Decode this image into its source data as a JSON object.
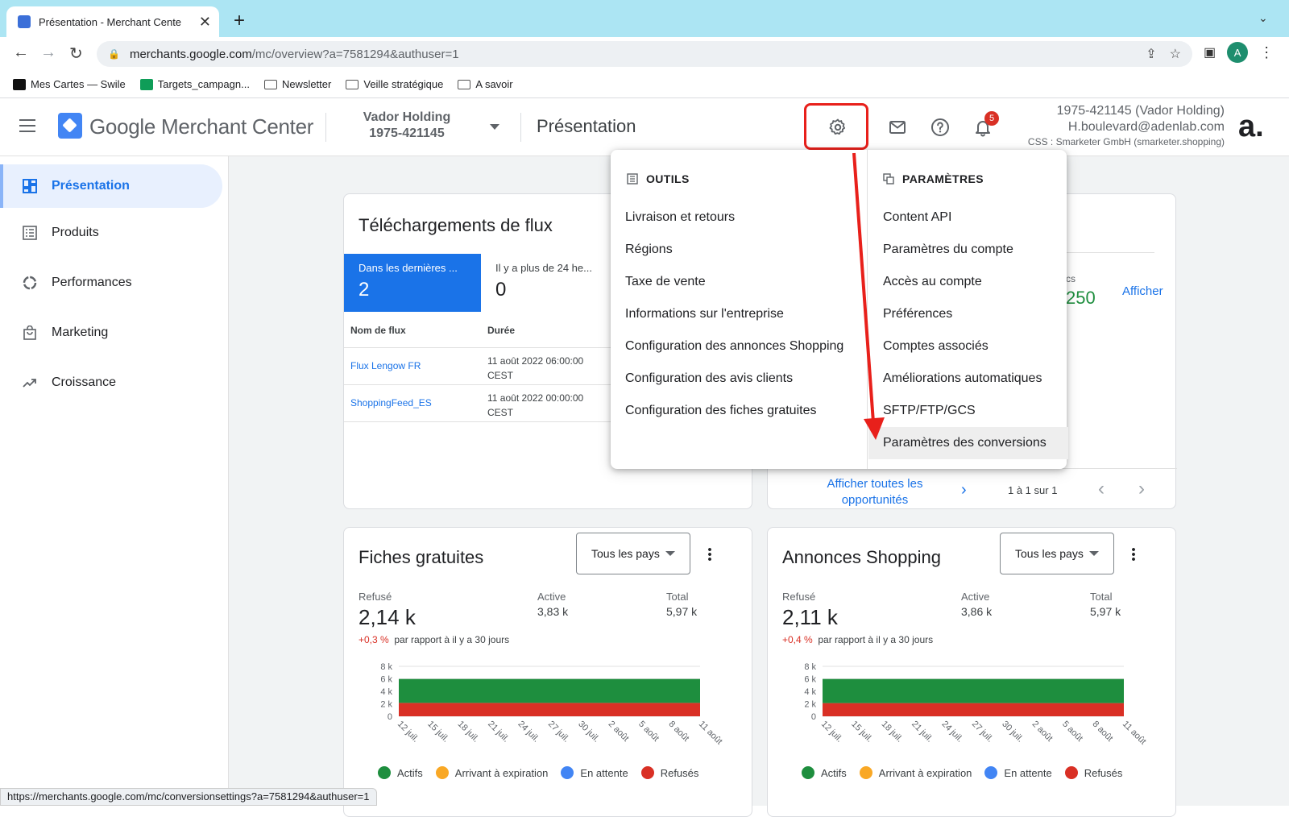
{
  "browser": {
    "tab_title": "Présentation - Merchant Cente",
    "url_host": "merchants.google.com",
    "url_path": "/mc/overview?a=7581294&authuser=1",
    "profile_initial": "A",
    "bookmarks": [
      {
        "label": "Mes Cartes — Swile"
      },
      {
        "label": "Targets_campagn..."
      },
      {
        "label": "Newsletter"
      },
      {
        "label": "Veille stratégique"
      },
      {
        "label": "A savoir"
      }
    ],
    "status_url": "https://merchants.google.com/mc/conversionsettings?a=7581294&authuser=1"
  },
  "header": {
    "app_name_google": "Google",
    "app_name_rest": " Merchant Center",
    "account_name": "Vador Holding",
    "account_id": "1975-421145",
    "page_title": "Présentation",
    "notifications_count": "5",
    "user_line1": "1975-421145 (Vador Holding)",
    "user_line2": "H.boulevard@adenlab.com",
    "user_line3": "CSS : Smarketer GmbH (smarketer.shopping)",
    "brand_letter": "a."
  },
  "sidebar": {
    "items": [
      {
        "label": "Présentation",
        "icon": "dashboard-icon"
      },
      {
        "label": "Produits",
        "icon": "list-icon"
      },
      {
        "label": "Performances",
        "icon": "donut-icon"
      },
      {
        "label": "Marketing",
        "icon": "shopping-bag-icon"
      },
      {
        "label": "Croissance",
        "icon": "trending-up-icon"
      }
    ]
  },
  "feeds_card": {
    "title": "Téléchargements de flux",
    "tab1_label": "Dans les dernières ...",
    "tab1_value": "2",
    "tab2_label": "Il y a plus de 24 he...",
    "tab2_value": "0",
    "col1": "Nom de flux",
    "col2": "Durée",
    "rows": [
      {
        "name": "Flux Lengow FR",
        "date1": "11 août 2022 06:00:00",
        "date2": "CEST"
      },
      {
        "name": "ShoppingFeed_ES",
        "date1": "11 août 2022 00:00:00",
        "date2": "CEST"
      }
    ]
  },
  "opps_card": {
    "partial_label": "cs",
    "partial_value": "250",
    "afficher": "Afficher",
    "all_link": "Afficher toutes les opportunités",
    "pager": "1 à 1 sur 1"
  },
  "menu": {
    "tools_header": "OUTILS",
    "tools": [
      "Livraison et retours",
      "Régions",
      "Taxe de vente",
      "Informations sur l'entreprise",
      "Configuration des annonces Shopping",
      "Configuration des avis clients",
      "Configuration des fiches gratuites"
    ],
    "settings_header": "PARAMÈTRES",
    "settings": [
      "Content API",
      "Paramètres du compte",
      "Accès au compte",
      "Préférences",
      "Comptes associés",
      "Améliorations automatiques",
      "SFTP/FTP/GCS",
      "Paramètres des conversions"
    ]
  },
  "free_card": {
    "title": "Fiches gratuites",
    "country": "Tous les pays",
    "refused_label": "Refusé",
    "refused_value": "2,14 k",
    "active_label": "Active",
    "active_value": "3,83 k",
    "total_label": "Total",
    "total_value": "5,97 k",
    "delta_value": "+0,3 %",
    "delta_text": "par rapport à il y a 30 jours"
  },
  "shopping_card": {
    "title": "Annonces Shopping",
    "country": "Tous les pays",
    "refused_label": "Refusé",
    "refused_value": "2,11 k",
    "active_label": "Active",
    "active_value": "3,86 k",
    "total_label": "Total",
    "total_value": "5,97 k",
    "delta_value": "+0,4 %",
    "delta_text": "par rapport à il y a 30 jours"
  },
  "legend": [
    {
      "label": "Actifs",
      "color": "#1e8e3e"
    },
    {
      "label": "Arrivant à expiration",
      "color": "#f9a825"
    },
    {
      "label": "En attente",
      "color": "#4285f4"
    },
    {
      "label": "Refusés",
      "color": "#d93025"
    }
  ],
  "chart_data": [
    {
      "type": "area",
      "title": "",
      "y_ticks": [
        "8 k",
        "6 k",
        "4 k",
        "2 k",
        "0"
      ],
      "ylim": [
        0,
        8000
      ],
      "x_labels": [
        "12 juil.",
        "15 juil.",
        "18 juil.",
        "21 juil.",
        "24 juil.",
        "27 juil.",
        "30 juil.",
        "2 août",
        "5 août",
        "8 août",
        "11 août"
      ],
      "series": [
        {
          "name": "Refusés",
          "values": [
            2140,
            2140,
            2140,
            2140,
            2140,
            2140,
            2140,
            2140,
            2140,
            2140,
            2140
          ]
        },
        {
          "name": "Actifs",
          "values": [
            3830,
            3830,
            3830,
            3830,
            3830,
            3830,
            3830,
            3830,
            3830,
            3830,
            3830
          ]
        }
      ]
    },
    {
      "type": "area",
      "title": "",
      "y_ticks": [
        "8 k",
        "6 k",
        "4 k",
        "2 k",
        "0"
      ],
      "ylim": [
        0,
        8000
      ],
      "x_labels": [
        "12 juil.",
        "15 juil.",
        "18 juil.",
        "21 juil.",
        "24 juil.",
        "27 juil.",
        "30 juil.",
        "2 août",
        "5 août",
        "8 août",
        "11 août"
      ],
      "series": [
        {
          "name": "Refusés",
          "values": [
            2110,
            2110,
            2110,
            2110,
            2110,
            2110,
            2110,
            2110,
            2110,
            2110,
            2110
          ]
        },
        {
          "name": "Actifs",
          "values": [
            3860,
            3860,
            3860,
            3860,
            3860,
            3860,
            3860,
            3860,
            3860,
            3860,
            3860
          ]
        }
      ]
    }
  ]
}
